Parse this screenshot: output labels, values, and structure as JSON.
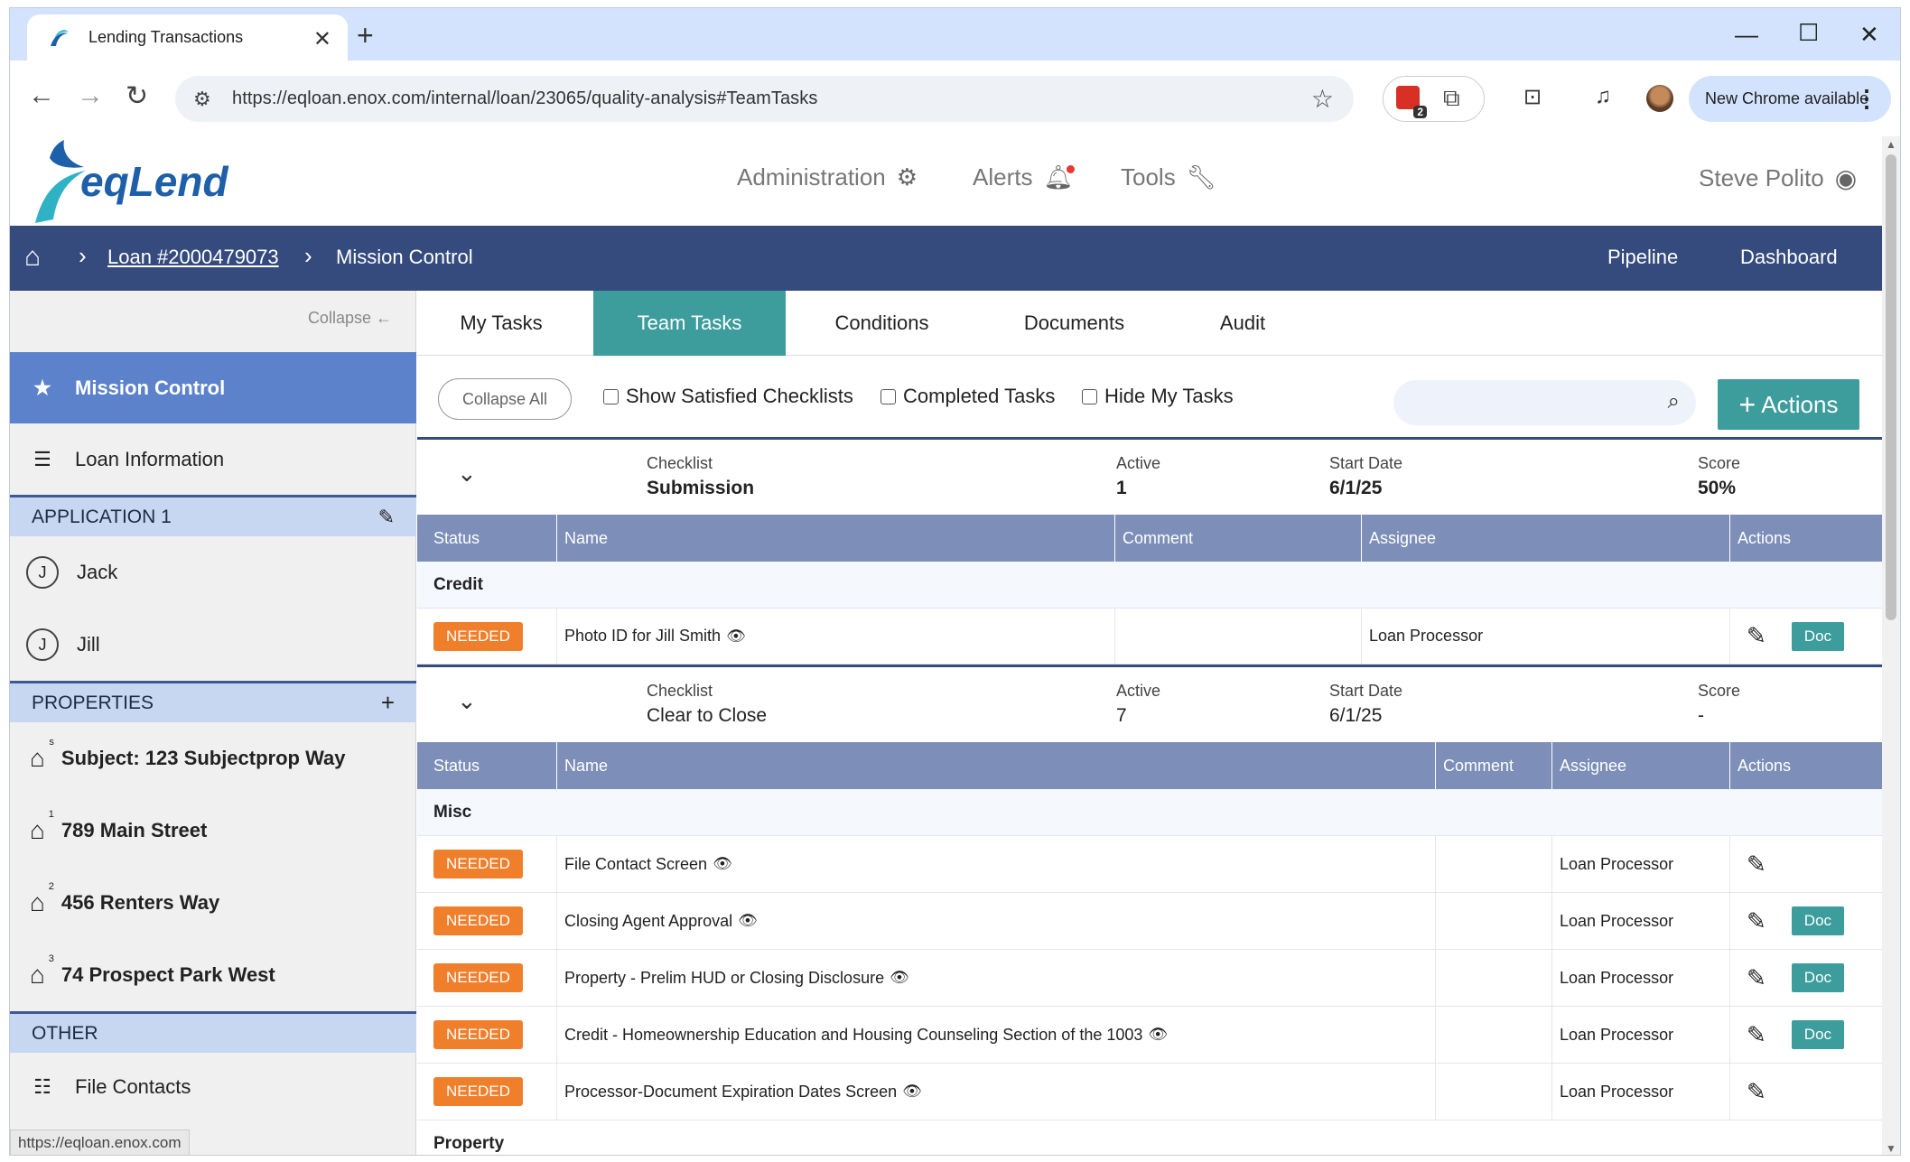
{
  "browser": {
    "tab_title": "Lending Transactions",
    "url": "https://eqloan.enox.com/internal/loan/23065/quality-analysis#TeamTasks",
    "extension_badge": "2",
    "update_label": "New Chrome available",
    "status_link": "https://eqloan.enox.com"
  },
  "header": {
    "logo_text": "eqLend",
    "nav": [
      "Administration",
      "Alerts",
      "Tools"
    ],
    "user": "Steve Polito"
  },
  "breadcrumb": {
    "loan": "Loan #2000479073",
    "current": "Mission Control",
    "right": [
      "Pipeline",
      "Dashboard"
    ]
  },
  "sidebar": {
    "collapse_label": "Collapse",
    "mission_control": "Mission Control",
    "loan_information": "Loan Information",
    "application_header": "APPLICATION 1",
    "applicants": [
      {
        "initial": "J",
        "name": "Jack"
      },
      {
        "initial": "J",
        "name": "Jill"
      }
    ],
    "properties_header": "PROPERTIES",
    "properties": [
      {
        "sup": "s",
        "label": "Subject: 123 Subjectprop Way"
      },
      {
        "sup": "1",
        "label": "789 Main Street"
      },
      {
        "sup": "2",
        "label": "456 Renters Way"
      },
      {
        "sup": "3",
        "label": "74 Prospect Park West"
      }
    ],
    "other_header": "OTHER",
    "file_contacts": "File Contacts"
  },
  "tabs": [
    "My Tasks",
    "Team Tasks",
    "Conditions",
    "Documents",
    "Audit"
  ],
  "active_tab": "Team Tasks",
  "filters": {
    "collapse_all": "Collapse All",
    "show_satisfied": "Show Satisfied Checklists",
    "completed_tasks": "Completed Tasks",
    "hide_my_tasks": "Hide My Tasks",
    "search_placeholder": "",
    "actions_label": "Actions"
  },
  "columns": {
    "status": "Status",
    "name": "Name",
    "comment": "Comment",
    "assignee": "Assignee",
    "actions": "Actions"
  },
  "checklists": [
    {
      "labels": {
        "checklist": "Checklist",
        "active": "Active",
        "start": "Start Date",
        "score": "Score"
      },
      "name": "Submission",
      "active": "1",
      "start_date": "6/1/25",
      "score": "50%",
      "group": "Credit",
      "tasks": [
        {
          "status": "NEEDED",
          "name": "Photo ID for Jill Smith",
          "comment": "",
          "assignee": "Loan Processor",
          "doc": "Doc"
        }
      ]
    },
    {
      "labels": {
        "checklist": "Checklist",
        "active": "Active",
        "start": "Start Date",
        "score": "Score"
      },
      "name": "Clear to Close",
      "active": "7",
      "start_date": "6/1/25",
      "score": "-",
      "group": "Misc",
      "next_group": "Property",
      "tasks": [
        {
          "status": "NEEDED",
          "name": "File Contact Screen",
          "comment": "",
          "assignee": "Loan Processor",
          "doc": ""
        },
        {
          "status": "NEEDED",
          "name": "Closing Agent Approval",
          "comment": "",
          "assignee": "Loan Processor",
          "doc": "Doc"
        },
        {
          "status": "NEEDED",
          "name": "Property - Prelim HUD or Closing Disclosure",
          "comment": "",
          "assignee": "Loan Processor",
          "doc": "Doc"
        },
        {
          "status": "NEEDED",
          "name": "Credit - Homeownership Education and Housing Counseling Section of the 1003",
          "comment": "",
          "assignee": "Loan Processor",
          "doc": "Doc"
        },
        {
          "status": "NEEDED",
          "name": "Processor-Document Expiration Dates Screen",
          "comment": "",
          "assignee": "Loan Processor",
          "doc": ""
        }
      ]
    }
  ],
  "colors": {
    "brand_blue": "#354b7d",
    "teal": "#3d9c9c",
    "needed_orange": "#f07f2c",
    "table_header": "#7d8fb8",
    "sidebar_active": "#5c82cc"
  }
}
